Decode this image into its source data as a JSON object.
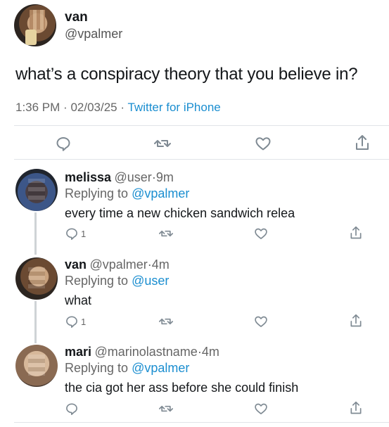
{
  "main_tweet": {
    "name": "van",
    "handle": "@vpalmer",
    "text": "what’s a conspiracy theory that you believe in?",
    "time": "1:36 PM",
    "date": "02/03/25",
    "sep": "·",
    "source": "Twitter for iPhone"
  },
  "actions": {
    "reply_icon": "reply-icon",
    "retweet_icon": "retweet-icon",
    "like_icon": "heart-icon",
    "share_icon": "share-icon",
    "icon_color": "#7f8a93"
  },
  "replies": [
    {
      "name": "melissa",
      "handle": "@user",
      "sep": "·",
      "age": "9m",
      "replying_label": "Replying to",
      "replying_to": "@vpalmer",
      "text": "every time a new chicken sandwich relea",
      "reply_count": "1"
    },
    {
      "name": "van",
      "handle": "@vpalmer",
      "sep": "·",
      "age": "4m",
      "replying_label": "Replying to",
      "replying_to": "@user",
      "text": "what",
      "reply_count": "1"
    },
    {
      "name": "mari",
      "handle": "@marinolastname",
      "sep": "·",
      "age": "4m",
      "replying_label": "Replying to",
      "replying_to": "@vpalmer",
      "text": "the cia got her ass before she could finish",
      "reply_count": ""
    }
  ],
  "colors": {
    "link": "#1b8ed0",
    "muted": "#666666",
    "divider": "#e1e4e8"
  }
}
